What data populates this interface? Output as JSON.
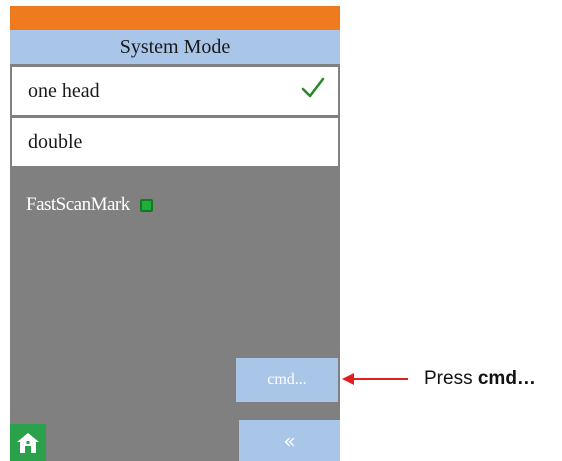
{
  "header": {
    "title": "System Mode"
  },
  "options": [
    {
      "label": "one head",
      "selected": true
    },
    {
      "label": "double",
      "selected": false
    }
  ],
  "fast_scan": {
    "label": "FastScanMark",
    "checked": true
  },
  "buttons": {
    "cmd_label": "cmd...",
    "back_label": "«"
  },
  "annotation": {
    "prefix": "Press ",
    "bold": "cmd…"
  },
  "colors": {
    "topbar": "#f07a1e",
    "accent": "#a9c5e8",
    "panel": "#808080",
    "check": "#2a8a2a",
    "home": "#2aa14a",
    "arrow": "#e0201e"
  },
  "icons": {
    "check": "check-icon",
    "home": "home-icon",
    "back": "double-chevron-left-icon"
  }
}
